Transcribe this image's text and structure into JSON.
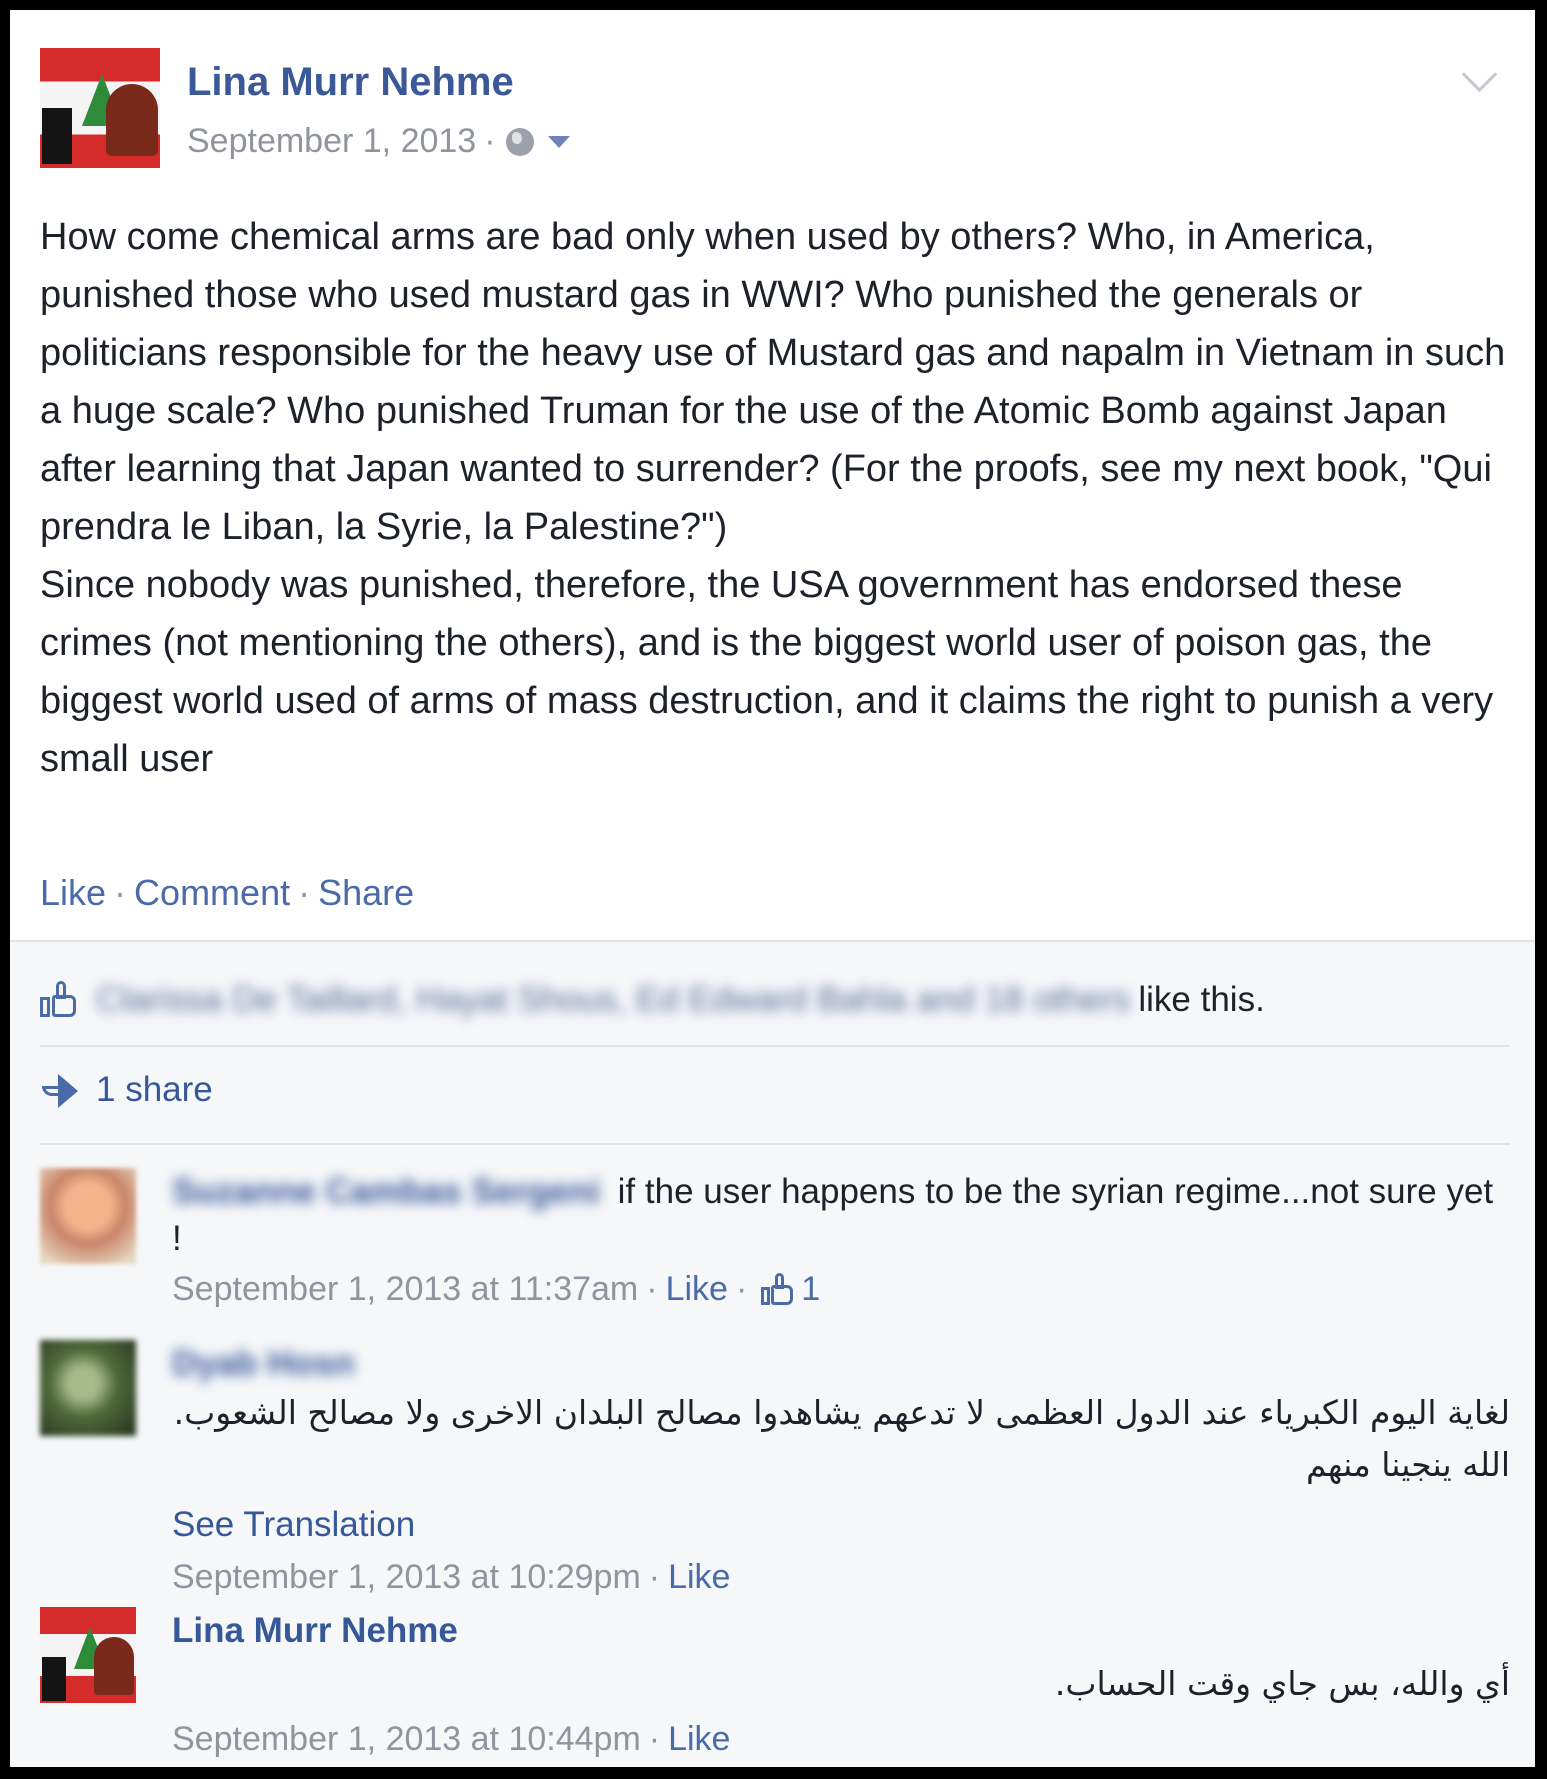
{
  "post": {
    "author": "Lina Murr Nehme",
    "date": "September 1, 2013",
    "date_separator": "·",
    "paragraphs": [
      "How come chemical arms are bad only when used by others? Who, in America, punished those who used mustard gas in WWI? Who punished the generals or politicians responsible for the heavy use of Mustard gas and napalm in Vietnam in such a huge scale? Who punished Truman for the use of the Atomic Bomb against Japan after learning that Japan wanted to surrender? (For the proofs, see my next book, \"Qui prendra le Liban, la Syrie, la Palestine?\")",
      "Since nobody was punished, therefore, the USA government has endorsed these crimes (not mentioning the others), and is the biggest world user of poison gas, the biggest world used of arms of mass destruction, and it claims the right to punish a very small user"
    ],
    "actions": {
      "like": "Like",
      "comment": "Comment",
      "share": "Share",
      "separator": "·"
    }
  },
  "likes": {
    "names_blurred": "Clarissa De Taillard, Hayat Shous, Ed Edward Bahla and 18 others",
    "suffix": "like this."
  },
  "shares": {
    "label": "1 share"
  },
  "comments": [
    {
      "name_blurred": "Suzanne Cambas Sergeni",
      "text": "if the user happens to be the syrian regime...not sure yet !",
      "timestamp": "September 1, 2013 at 11:37am",
      "like_label": "Like",
      "like_count": "1"
    },
    {
      "name_blurred": "Dyab Hosn",
      "text": "لغاية اليوم الكبرياء عند الدول العظمى لا تدعهم يشاهدوا مصالح البلدان الاخرى ولا مصالح الشعوب. الله ينجينا منهم",
      "see_translation": "See Translation",
      "timestamp": "September 1, 2013 at 10:29pm",
      "like_label": "Like"
    },
    {
      "name": "Lina Murr Nehme",
      "text": "أي والله، بس جاي وقت الحساب.",
      "timestamp": "September 1, 2013 at 10:44pm",
      "like_label": "Like"
    }
  ],
  "icons": {
    "audience": "globe-icon",
    "audience_menu": "caret-icon",
    "post_menu": "chevron-down-icon",
    "like": "thumbs-up-icon",
    "share": "share-arrow-icon"
  },
  "colors": {
    "link": "#365899",
    "meta": "#90949c",
    "text": "#1d2129",
    "lower_bg": "#f6f7f9"
  }
}
